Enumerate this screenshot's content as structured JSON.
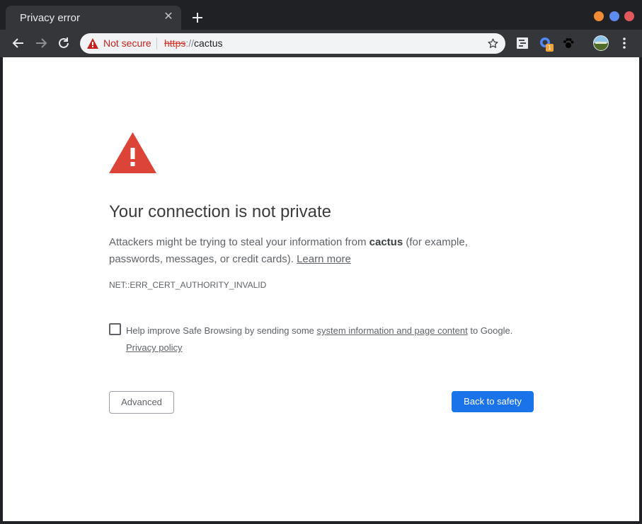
{
  "tab": {
    "title": "Privacy error"
  },
  "omnibox": {
    "security_label": "Not secure",
    "url_scheme": "https",
    "url_separator": "://",
    "url_host": "cactus"
  },
  "extensions": {
    "badge_count": "1"
  },
  "page": {
    "heading": "Your connection is not private",
    "explanation_before": "Attackers might be trying to steal your information from ",
    "explanation_host": "cactus",
    "explanation_after": " (for example, passwords, messages, or credit cards). ",
    "learn_more": "Learn more",
    "error_code": "NET::ERR_CERT_AUTHORITY_INVALID",
    "safe_browsing_before": "Help improve Safe Browsing by sending some ",
    "safe_browsing_link": "system information and page content",
    "safe_browsing_after": " to Google.",
    "privacy_policy": "Privacy policy",
    "advanced_button": "Advanced",
    "back_button": "Back to safety"
  },
  "colors": {
    "danger": "#db4437",
    "primary_button": "#1a73e8",
    "not_secure": "#c5221f"
  },
  "icons": [
    "new-tab-icon",
    "back-icon",
    "forward-icon",
    "reload-icon",
    "warning-icon",
    "star-icon",
    "reader-icon",
    "extension-icon",
    "paw-icon",
    "profile-avatar",
    "menu-icon",
    "danger-triangle-icon"
  ]
}
